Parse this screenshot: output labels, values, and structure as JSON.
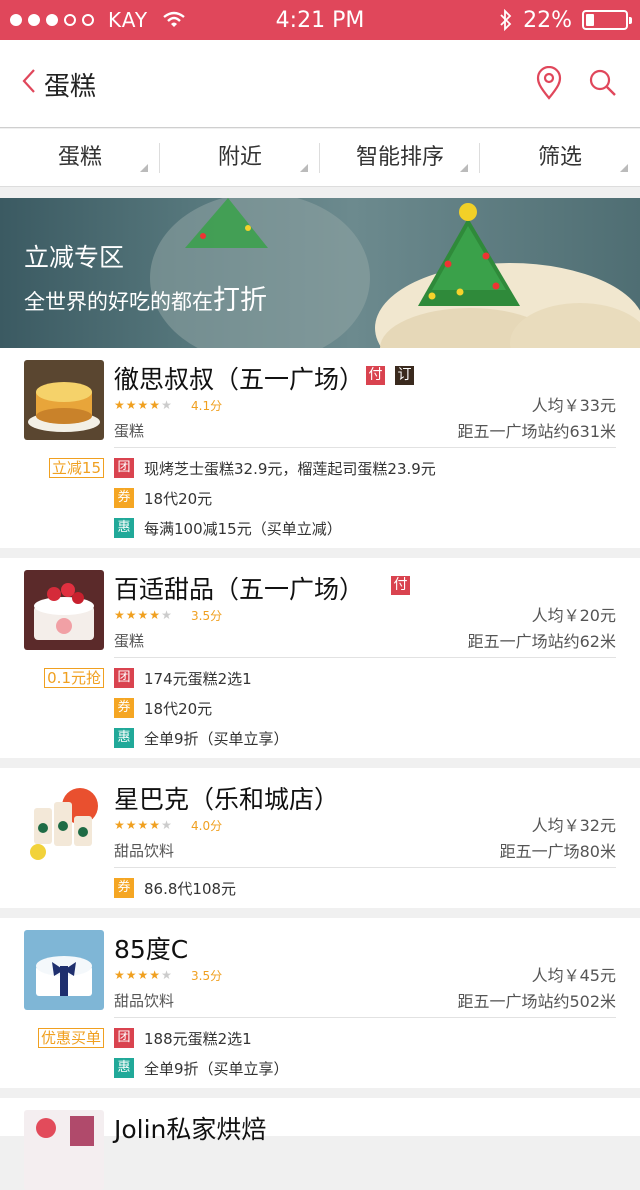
{
  "status_bar": {
    "carrier": "KAY",
    "time": "4:21 PM",
    "battery": "22%",
    "battery_level": 0.22
  },
  "nav": {
    "title": "蛋糕"
  },
  "filters": [
    "蛋糕",
    "附近",
    "智能排序",
    "筛选"
  ],
  "banner": {
    "line1": "立减专区",
    "line2_prefix": "全世界的好吃的都在",
    "line2_highlight": "打折"
  },
  "shops": [
    {
      "name": "徹思叔叔（五一广场）",
      "tags": [
        "付",
        "订"
      ],
      "rating": 4.1,
      "score": "4.1分",
      "category": "蛋糕",
      "avg_price": "人均￥33元",
      "distance": "距五一广场站约631米",
      "badge": "立减15",
      "deals": [
        {
          "type": "团",
          "text": "现烤芝士蛋糕32.9元，榴莲起司蛋糕23.9元"
        },
        {
          "type": "券",
          "text": "18代20元"
        },
        {
          "type": "惠",
          "text": "每满100减15元（买单立减）"
        }
      ]
    },
    {
      "name": "百适甜品（五一广场）",
      "tags": [
        "付"
      ],
      "rating": 3.5,
      "score": "3.5分",
      "category": "蛋糕",
      "avg_price": "人均￥20元",
      "distance": "距五一广场站约62米",
      "badge": "0.1元抢",
      "deals": [
        {
          "type": "团",
          "text": "174元蛋糕2选1"
        },
        {
          "type": "券",
          "text": "18代20元"
        },
        {
          "type": "惠",
          "text": "全单9折（买单立享）"
        }
      ]
    },
    {
      "name": "星巴克（乐和城店）",
      "tags": [],
      "rating": 4.0,
      "score": "4.0分",
      "category": "甜品饮料",
      "avg_price": "人均￥32元",
      "distance": "距五一广场80米",
      "badge": "",
      "deals": [
        {
          "type": "券",
          "text": "86.8代108元"
        }
      ]
    },
    {
      "name": "85度C",
      "tags": [],
      "rating": 3.5,
      "score": "3.5分",
      "category": "甜品饮料",
      "avg_price": "人均￥45元",
      "distance": "距五一广场站约502米",
      "badge": "优惠买单",
      "deals": [
        {
          "type": "团",
          "text": "188元蛋糕2选1"
        },
        {
          "type": "惠",
          "text": "全单9折（买单立享）"
        }
      ]
    },
    {
      "name": "Jolin私家烘焙",
      "tags": [],
      "rating": 0,
      "score": "",
      "category": "",
      "avg_price": "",
      "distance": "",
      "badge": "",
      "deals": []
    }
  ]
}
